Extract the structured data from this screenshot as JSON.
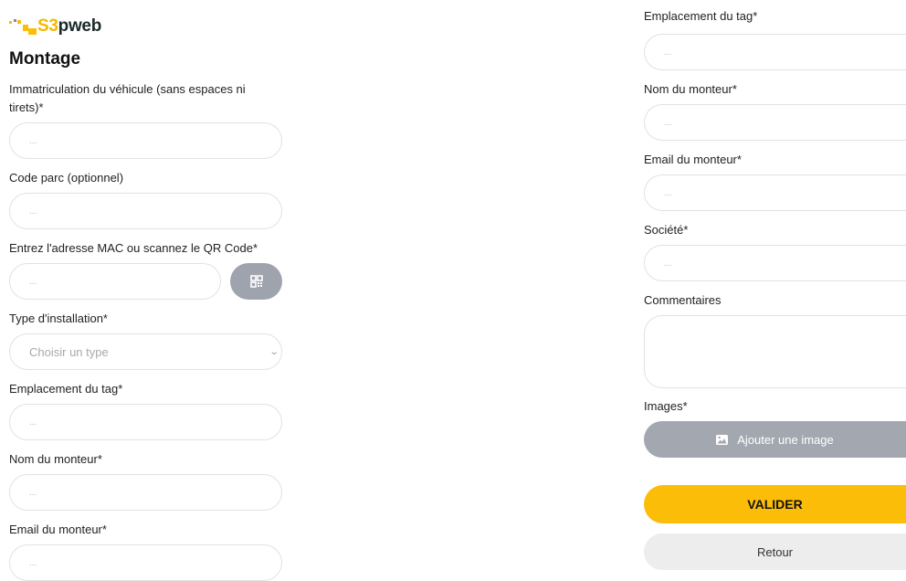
{
  "brand": {
    "name_prefix": "S3",
    "name_suffix": "pweb",
    "colors": {
      "yellow": "#fbbd08",
      "green": "#1b2a2a"
    }
  },
  "page": {
    "title": "Montage"
  },
  "form": {
    "placeholder": "...",
    "immatriculation": {
      "label": "Immatriculation du véhicule (sans espaces ni tirets)*"
    },
    "code_parc": {
      "label": "Code parc (optionnel)"
    },
    "mac": {
      "label": "Entrez l'adresse MAC ou scannez le QR Code*",
      "scan_icon": "qr-code-icon"
    },
    "type_installation": {
      "label": "Type d'installation*",
      "selected": "Choisir un type"
    },
    "emplacement_tag": {
      "label": "Emplacement du tag*"
    },
    "nom_monteur": {
      "label": "Nom du monteur*"
    },
    "email_monteur": {
      "label": "Email du monteur*"
    },
    "societe": {
      "label": "Société*"
    },
    "commentaires": {
      "label": "Commentaires"
    },
    "images": {
      "label": "Images*",
      "button_label": "Ajouter une image",
      "button_icon": "image-icon"
    }
  },
  "actions": {
    "submit_label": "VALIDER",
    "back_label": "Retour"
  },
  "colors": {
    "primary": "#fbbd08",
    "secondary_button": "#a3a8b0",
    "back_button": "#ededed"
  }
}
